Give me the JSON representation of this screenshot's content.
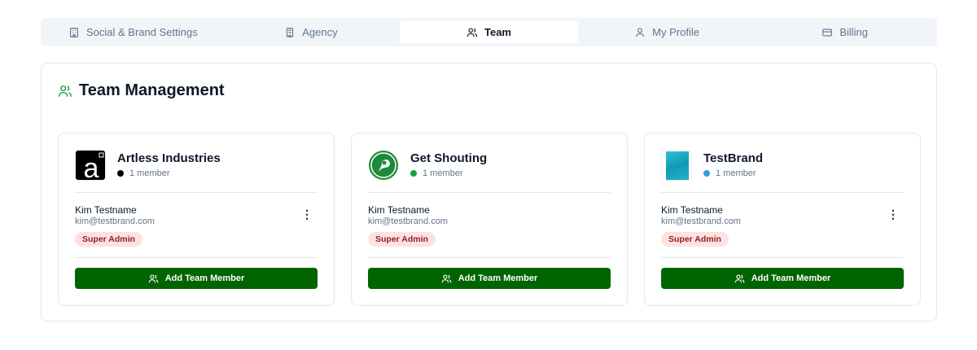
{
  "tabs": [
    {
      "label": "Social & Brand Settings",
      "icon": "building-icon"
    },
    {
      "label": "Agency",
      "icon": "office-icon"
    },
    {
      "label": "Team",
      "icon": "users-icon",
      "active": true
    },
    {
      "label": "My Profile",
      "icon": "user-icon"
    },
    {
      "label": "Billing",
      "icon": "credit-card-icon"
    }
  ],
  "title": "Team Management",
  "accent": "#006400",
  "brands": [
    {
      "name": "Artless Industries",
      "count": "1 member",
      "dot": "#000000",
      "member": "Kim Testname",
      "email": "kim@testbrand.com",
      "role": "Super Admin",
      "menu": "⋮",
      "button": "Add Team Member"
    },
    {
      "name": "Get Shouting",
      "count": "1 member",
      "dot": "#15a33a",
      "member": "Kim Testname",
      "email": "kim@testbrand.com",
      "role": "Super Admin",
      "button": "Add Team Member"
    },
    {
      "name": "TestBrand",
      "count": "1 member",
      "dot": "#3b9ad9",
      "member": "Kim Testname",
      "email": "kim@testbrand.com",
      "role": "Super Admin",
      "menu": "⋮",
      "button": "Add Team Member"
    }
  ]
}
